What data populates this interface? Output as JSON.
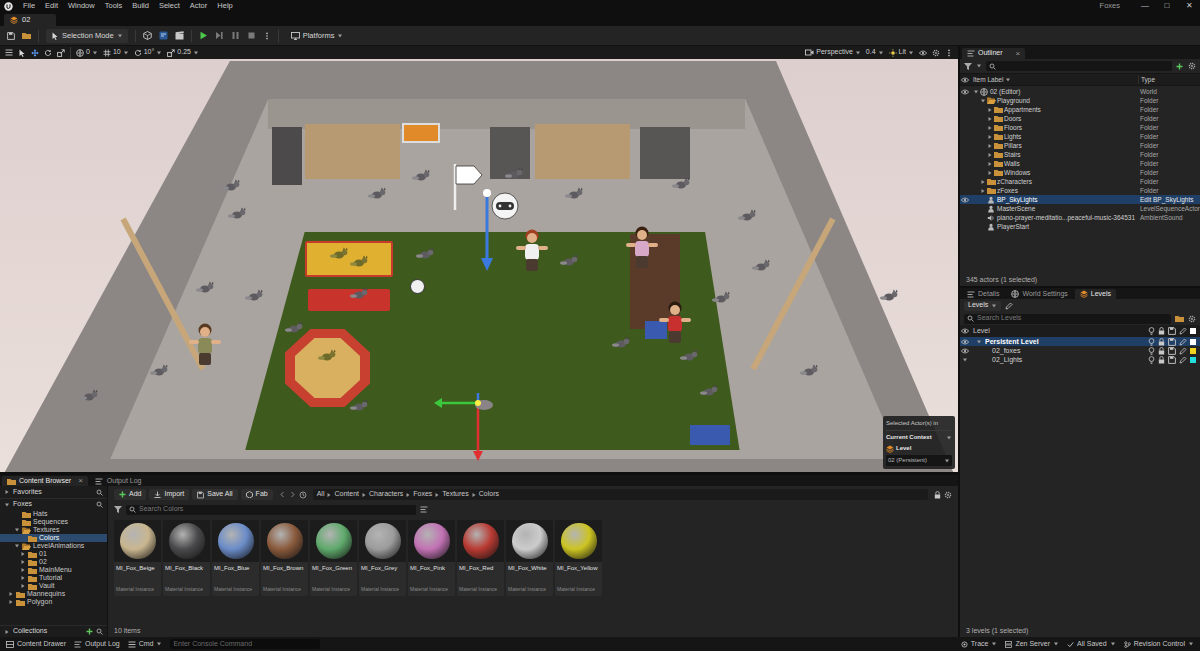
{
  "window": {
    "title": "Foxes",
    "menu": [
      "File",
      "Edit",
      "Window",
      "Tools",
      "Build",
      "Select",
      "Actor",
      "Help"
    ],
    "controls": [
      "—",
      "□",
      "✕"
    ]
  },
  "document_tab": {
    "label": "02"
  },
  "toolbar": {
    "mode": "Selection Mode",
    "platforms": "Platforms"
  },
  "viewport": {
    "toolbar": {
      "snap_values": [
        "0",
        "10",
        "10°",
        "0.25"
      ],
      "view": "Perspective",
      "fov": "0.4",
      "lit": "Lit"
    },
    "overlay": {
      "title": "Selected Actor(s) in",
      "context": "Current Context",
      "level_label": "Level",
      "level": "02 (Persistent)"
    }
  },
  "outliner": {
    "title": "Outliner",
    "close": "×",
    "columns": [
      "Item Label",
      "Type"
    ],
    "rows": [
      {
        "label": "02 (Editor)",
        "type": "World",
        "depth": 0,
        "kind": "world",
        "expanded": true,
        "visible": true,
        "selected": false
      },
      {
        "label": "Playground",
        "type": "Folder",
        "depth": 1,
        "kind": "folder",
        "expanded": true,
        "visible": false,
        "selected": false
      },
      {
        "label": "Appartments",
        "type": "Folder",
        "depth": 2,
        "kind": "folder",
        "expanded": false,
        "visible": false,
        "selected": false
      },
      {
        "label": "Doors",
        "type": "Folder",
        "depth": 2,
        "kind": "folder",
        "expanded": false,
        "visible": false,
        "selected": false
      },
      {
        "label": "Floors",
        "type": "Folder",
        "depth": 2,
        "kind": "folder",
        "expanded": false,
        "visible": false,
        "selected": false
      },
      {
        "label": "Lights",
        "type": "Folder",
        "depth": 2,
        "kind": "folder",
        "expanded": false,
        "visible": false,
        "selected": false
      },
      {
        "label": "Pillars",
        "type": "Folder",
        "depth": 2,
        "kind": "folder",
        "expanded": false,
        "visible": false,
        "selected": false
      },
      {
        "label": "Stairs",
        "type": "Folder",
        "depth": 2,
        "kind": "folder",
        "expanded": false,
        "visible": false,
        "selected": false
      },
      {
        "label": "Walls",
        "type": "Folder",
        "depth": 2,
        "kind": "folder",
        "expanded": false,
        "visible": false,
        "selected": false
      },
      {
        "label": "Windows",
        "type": "Folder",
        "depth": 2,
        "kind": "folder",
        "expanded": false,
        "visible": false,
        "selected": false
      },
      {
        "label": "zCharacters",
        "type": "Folder",
        "depth": 1,
        "kind": "folder",
        "expanded": false,
        "visible": false,
        "selected": false
      },
      {
        "label": "zFoxes",
        "type": "Folder",
        "depth": 1,
        "kind": "folder",
        "expanded": false,
        "visible": false,
        "selected": false
      },
      {
        "label": "BP_SkyLights",
        "type": "Edit BP_SkyLights",
        "depth": 1,
        "kind": "actor",
        "visible": true,
        "selected": true
      },
      {
        "label": "MasterScene",
        "type": "LevelSequenceActor",
        "depth": 1,
        "kind": "actor",
        "visible": false,
        "selected": false
      },
      {
        "label": "piano-prayer-meditatio...peaceful-music-364531",
        "type": "AmbientSound",
        "depth": 1,
        "kind": "sound",
        "visible": false,
        "selected": false
      },
      {
        "label": "PlayerStart",
        "depth": 1,
        "kind": "actor",
        "visible": false,
        "selected": false
      }
    ],
    "footer": "345 actors (1 selected)"
  },
  "details_panel": {
    "tabs": [
      {
        "label": "Details",
        "selected": false
      },
      {
        "label": "World Settings",
        "selected": false
      },
      {
        "label": "Levels",
        "selected": true
      }
    ],
    "levels_button": "Levels",
    "search_placeholder": "Search Levels",
    "column": "Level",
    "rows": [
      {
        "label": "Persistent Level",
        "depth": 0,
        "expanded": true,
        "visible": true,
        "selected": true,
        "color": "#ffffff"
      },
      {
        "label": "02_foxes",
        "depth": 1,
        "visible": true,
        "selected": false,
        "color": "#f2d41f"
      },
      {
        "label": "02_Lights",
        "depth": 1,
        "visible": false,
        "selected": false,
        "color": "#22e0e0"
      }
    ],
    "footer": "3 levels (1 selected)"
  },
  "content_browser": {
    "tabs": [
      {
        "label": "Content Browser",
        "selected": true
      },
      {
        "label": "Output Log",
        "selected": false
      }
    ],
    "close": "×",
    "favorites": "Favorites",
    "root": "Foxes",
    "tree": [
      {
        "label": "Hats",
        "depth": 2,
        "selected": false
      },
      {
        "label": "Sequences",
        "depth": 2,
        "selected": false
      },
      {
        "label": "Textures",
        "depth": 2,
        "expanded": true,
        "selected": false
      },
      {
        "label": "Colors",
        "depth": 3,
        "selected": true
      },
      {
        "label": "LevelAnimations",
        "depth": 2,
        "expanded": true,
        "selected": false
      },
      {
        "label": "01",
        "depth": 3,
        "expanded": false,
        "selected": false
      },
      {
        "label": "02",
        "depth": 3,
        "expanded": false,
        "selected": false
      },
      {
        "label": "MainMenu",
        "depth": 3,
        "expanded": false,
        "selected": false
      },
      {
        "label": "Tutorial",
        "depth": 3,
        "expanded": false,
        "selected": false
      },
      {
        "label": "Vault",
        "depth": 3,
        "expanded": false,
        "selected": false
      },
      {
        "label": "Mannequins",
        "depth": 1,
        "expanded": false,
        "selected": false
      },
      {
        "label": "Polygon",
        "depth": 1,
        "expanded": false,
        "selected": false
      }
    ],
    "collections": "Collections",
    "buttons": {
      "add": "Add",
      "import": "Import",
      "save_all": "Save All",
      "fab": "Fab"
    },
    "breadcrumb": [
      "All",
      "Content",
      "Characters",
      "Foxes",
      "Textures",
      "Colors"
    ],
    "search_placeholder": "Search Colors",
    "assets": [
      {
        "name": "MI_Fox_Beige",
        "type": "Material Instance",
        "color": "#c9b68f"
      },
      {
        "name": "MI_Fox_Black",
        "type": "Material Instance",
        "color": "#4a4a4c"
      },
      {
        "name": "MI_Fox_Blue",
        "type": "Material Instance",
        "color": "#6a8cc8"
      },
      {
        "name": "MI_Fox_Brown",
        "type": "Material Instance",
        "color": "#8a5a3c"
      },
      {
        "name": "MI_Fox_Green",
        "type": "Material Instance",
        "color": "#5faa6c"
      },
      {
        "name": "MI_Fox_Grey",
        "type": "Material Instance",
        "color": "#9c9c9c"
      },
      {
        "name": "MI_Fox_Pink",
        "type": "Material Instance",
        "color": "#c272b4"
      },
      {
        "name": "MI_Fox_Red",
        "type": "Material Instance",
        "color": "#b83a32"
      },
      {
        "name": "MI_Fox_White",
        "type": "Material Instance",
        "color": "#cccccc"
      },
      {
        "name": "MI_Fox_Yellow",
        "type": "Material Instance",
        "color": "#ccc422"
      }
    ],
    "count": "10 items"
  },
  "status_bar": {
    "left": [
      "Content Drawer",
      "Output Log",
      "Cmd"
    ],
    "console_placeholder": "Enter Console Command",
    "right": [
      "Trace",
      "Zen Server",
      "All Saved",
      "Revision Control"
    ]
  }
}
